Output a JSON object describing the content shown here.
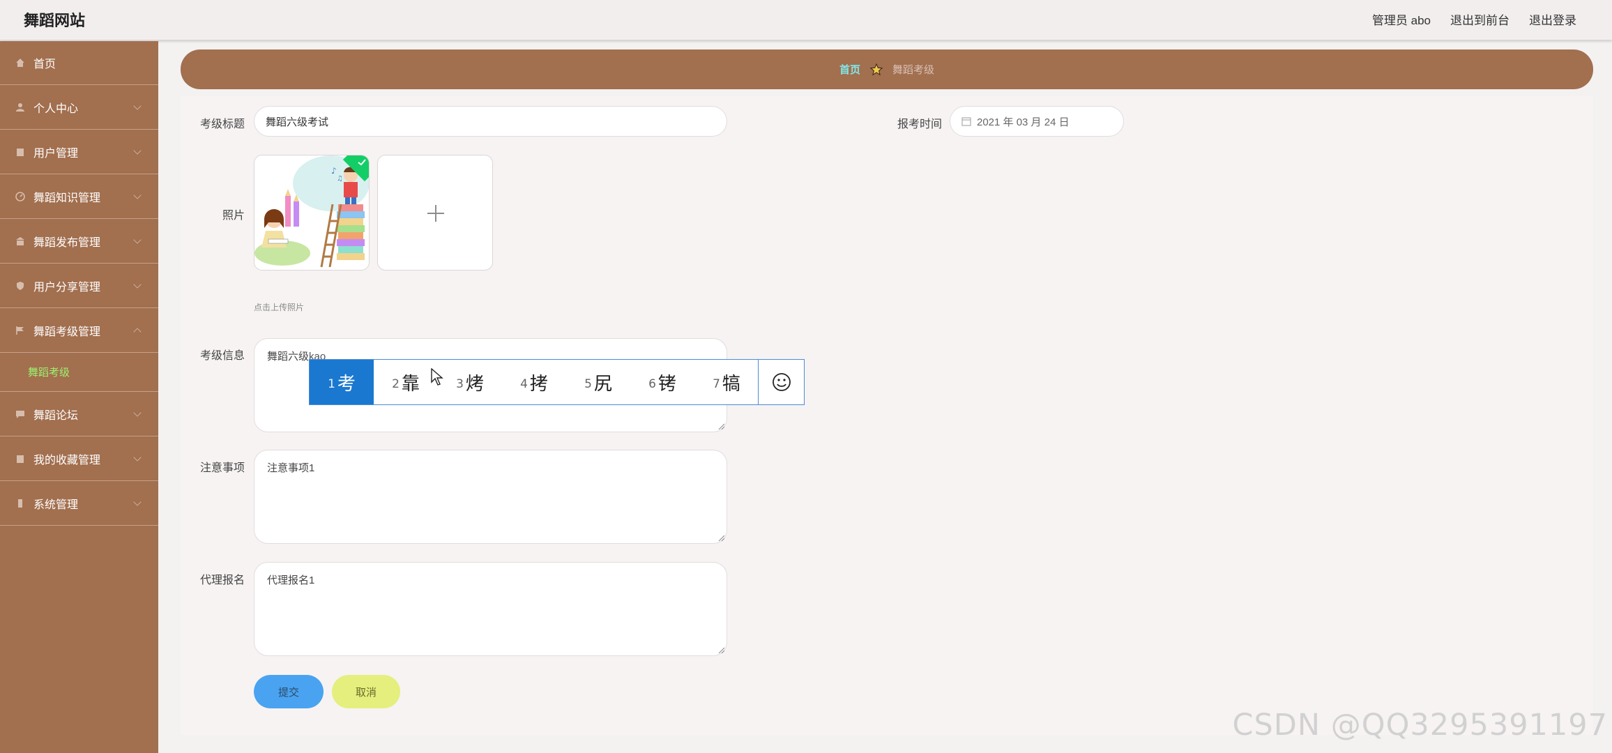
{
  "header": {
    "brand": "舞蹈网站",
    "links": [
      "管理员 abo",
      "退出到前台",
      "退出登录"
    ]
  },
  "sidebar": {
    "items": [
      {
        "label": "首页",
        "icon": "home-icon"
      },
      {
        "label": "个人中心",
        "icon": "user-icon"
      },
      {
        "label": "用户管理",
        "icon": "building-icon"
      },
      {
        "label": "舞蹈知识管理",
        "icon": "gauge-icon"
      },
      {
        "label": "舞蹈发布管理",
        "icon": "bank-icon"
      },
      {
        "label": "用户分享管理",
        "icon": "shield-icon"
      },
      {
        "label": "舞蹈考级管理",
        "icon": "flag-icon"
      },
      {
        "label": "舞蹈论坛",
        "icon": "chat-icon"
      },
      {
        "label": "我的收藏管理",
        "icon": "building-icon"
      },
      {
        "label": "系统管理",
        "icon": "tower-icon"
      }
    ],
    "active_sub": "舞蹈考级"
  },
  "breadcrumb": {
    "home": "首页",
    "current": "舞蹈考级"
  },
  "form": {
    "title_label": "考级标题",
    "title_value": "舞蹈六级考试",
    "date_label": "报考时间",
    "date_value": "2021 年 03 月 24 日",
    "photo_label": "照片",
    "upload_hint": "点击上传照片",
    "info_label": "考级信息",
    "info_value": "舞蹈六级",
    "info_composing": "kao",
    "notes_label": "注意事项",
    "notes_value": "注意事项1",
    "proxy_label": "代理报名",
    "proxy_value": "代理报名1",
    "submit": "提交",
    "cancel": "取消"
  },
  "ime": {
    "candidates": [
      {
        "n": "1",
        "c": "考"
      },
      {
        "n": "2",
        "c": "靠"
      },
      {
        "n": "3",
        "c": "烤"
      },
      {
        "n": "4",
        "c": "拷"
      },
      {
        "n": "5",
        "c": "尻"
      },
      {
        "n": "6",
        "c": "铐"
      },
      {
        "n": "7",
        "c": "犒"
      }
    ],
    "selected": 0
  },
  "watermark": "CSDN @QQ3295391197",
  "colors": {
    "sidebar": "#a26f4f",
    "active_sub": "#9df26f",
    "crumb_home": "#7fe7e7",
    "submit": "#4aa3f0",
    "cancel": "#e4ef7e",
    "ime_selected": "#1b78d0"
  }
}
